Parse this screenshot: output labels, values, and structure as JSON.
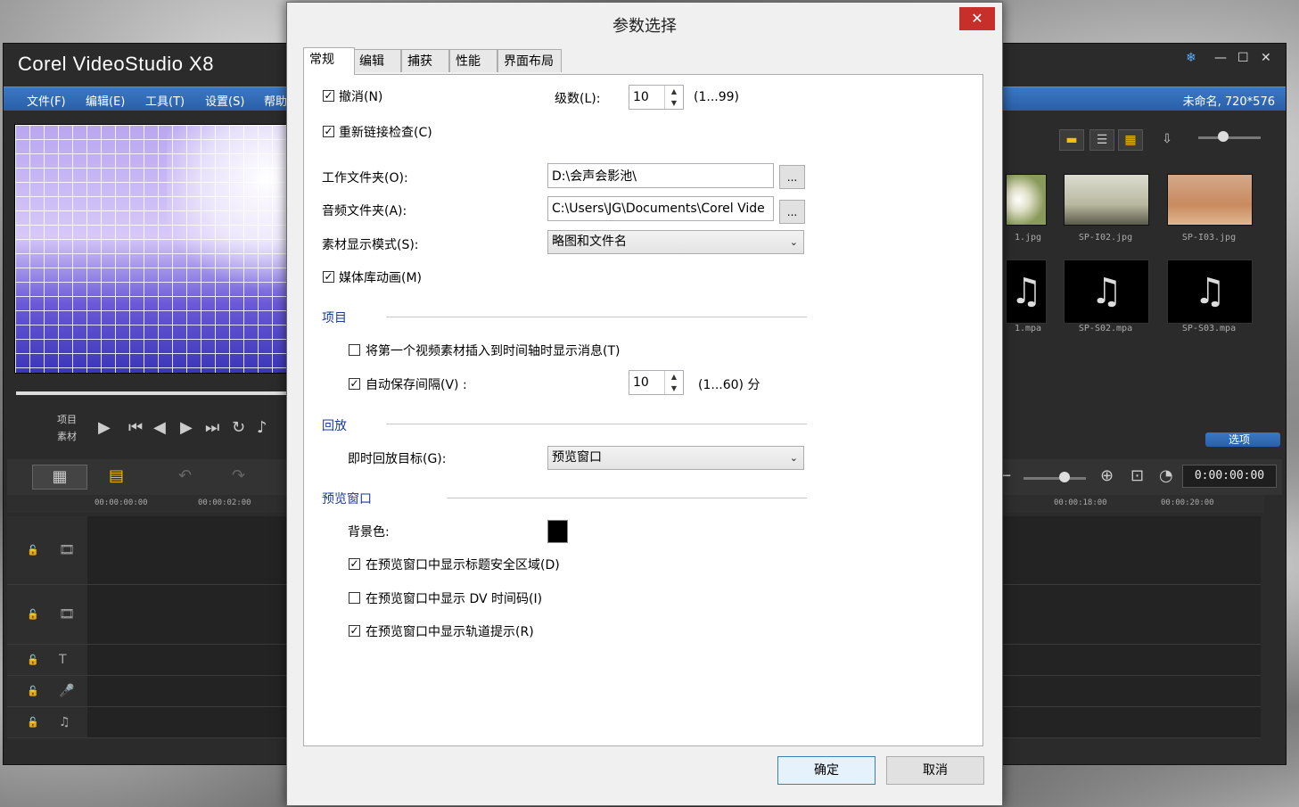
{
  "app": {
    "title": "Corel VideoStudio X8",
    "project_info": "未命名, 720*576",
    "menu": [
      "文件(F)",
      "编辑(E)",
      "工具(T)",
      "设置(S)",
      "帮助"
    ],
    "player_labels": {
      "project": "项目",
      "clip": "素材"
    },
    "library": {
      "thumbs": [
        "1.jpg",
        "SP-I02.jpg",
        "SP-I03.jpg"
      ],
      "audio": [
        "1.mpa",
        "SP-S02.mpa",
        "SP-S03.mpa"
      ]
    },
    "options_label": "选项",
    "timecode": "0:00:00:00",
    "ruler": [
      "00:00:00:00",
      "00:00:02:00",
      "00:00:18:00",
      "00:00:20:00"
    ]
  },
  "dialog": {
    "title": "参数选择",
    "close_glyph": "✕",
    "tabs": [
      "常规",
      "编辑",
      "捕获",
      "性能",
      "界面布局"
    ],
    "active_tab": 0,
    "undo": {
      "label": "撤消(N)",
      "checked": true
    },
    "levels": {
      "label": "级数(L):",
      "value": "10",
      "range": "(1...99)"
    },
    "relink": {
      "label": "重新链接检查(C)",
      "checked": true
    },
    "work_folder": {
      "label": "工作文件夹(O):",
      "value": "D:\\会声会影池\\",
      "browse": "..."
    },
    "audio_folder": {
      "label": "音频文件夹(A):",
      "value": "C:\\Users\\JG\\Documents\\Corel Vide",
      "browse": "..."
    },
    "display_mode": {
      "label": "素材显示模式(S):",
      "value": "略图和文件名"
    },
    "library_anim": {
      "label": "媒体库动画(M)",
      "checked": true
    },
    "section_project": "项目",
    "insert_msg": {
      "label": "将第一个视频素材插入到时间轴时显示消息(T)",
      "checked": false
    },
    "autosave": {
      "label": "自动保存间隔(V) :",
      "value": "10",
      "range": "(1...60) 分",
      "checked": true
    },
    "section_playback": "回放",
    "playback_target": {
      "label": "即时回放目标(G):",
      "value": "预览窗口"
    },
    "section_preview": "预览窗口",
    "bg_color": {
      "label": "背景色:",
      "color": "#000000"
    },
    "show_safe": {
      "label": "在预览窗口中显示标题安全区域(D)",
      "checked": true
    },
    "show_dv": {
      "label": "在预览窗口中显示 DV 时间码(I)",
      "checked": false
    },
    "show_track": {
      "label": "在预览窗口中显示轨道提示(R)",
      "checked": true
    },
    "ok": "确定",
    "cancel": "取消"
  }
}
